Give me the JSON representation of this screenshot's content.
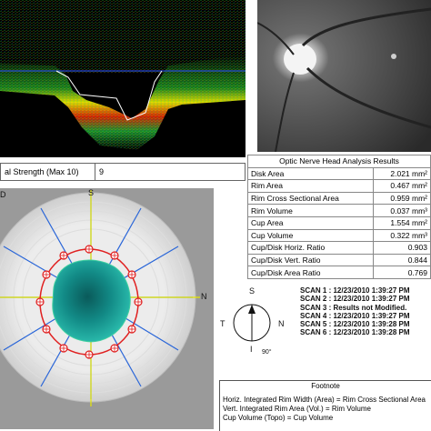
{
  "signal_strength": {
    "label": "al Strength (Max 10)",
    "value": "9"
  },
  "onh": {
    "title": "Optic Nerve Head Analysis Results",
    "rows": [
      {
        "label": "Disk Area",
        "value": "2.021 mm²"
      },
      {
        "label": "Rim Area",
        "value": "0.467 mm²"
      },
      {
        "label": "Rim Cross Sectional Area",
        "value": "0.959 mm²"
      },
      {
        "label": "Rim Volume",
        "value": "0.037 mm³"
      },
      {
        "label": "Cup Area",
        "value": "1.554 mm²"
      },
      {
        "label": "Cup Volume",
        "value": "0.322 mm³"
      },
      {
        "label": "Cup/Disk Horiz. Ratio",
        "value": "0.903"
      },
      {
        "label": "Cup/Disk Vert. Ratio",
        "value": "0.844"
      },
      {
        "label": "Cup/Disk Area Ratio",
        "value": "0.769"
      }
    ]
  },
  "scans": [
    "SCAN 1 : 12/23/2010 1:39:27 PM",
    "SCAN 2 : 12/23/2010 1:39:27 PM",
    "SCAN 3 : Results not Modified.",
    "SCAN 4 : 12/23/2010 1:39:27 PM",
    "SCAN 5 : 12/23/2010 1:39:28 PM",
    "SCAN 6 : 12/23/2010 1:39:28 PM"
  ],
  "compass": {
    "top": "S",
    "left": "T",
    "right": "N",
    "bottom": "I",
    "angle": "90°"
  },
  "topo_labels": {
    "top": "S",
    "right": "N",
    "left": "D"
  },
  "footnote": {
    "title": "Footnote",
    "lines": [
      "Horiz. Integrated Rim Width (Area) = Rim Cross Sectional Area",
      "Vert. Integrated Rim Area (Vol.) = Rim Volume",
      "Cup Volume (Topo) = Cup Volume"
    ]
  },
  "colors": {
    "cup": "#1aa7a0",
    "rim": "#e02020",
    "axis": "#e6e600",
    "radial": "#2a66d8"
  }
}
